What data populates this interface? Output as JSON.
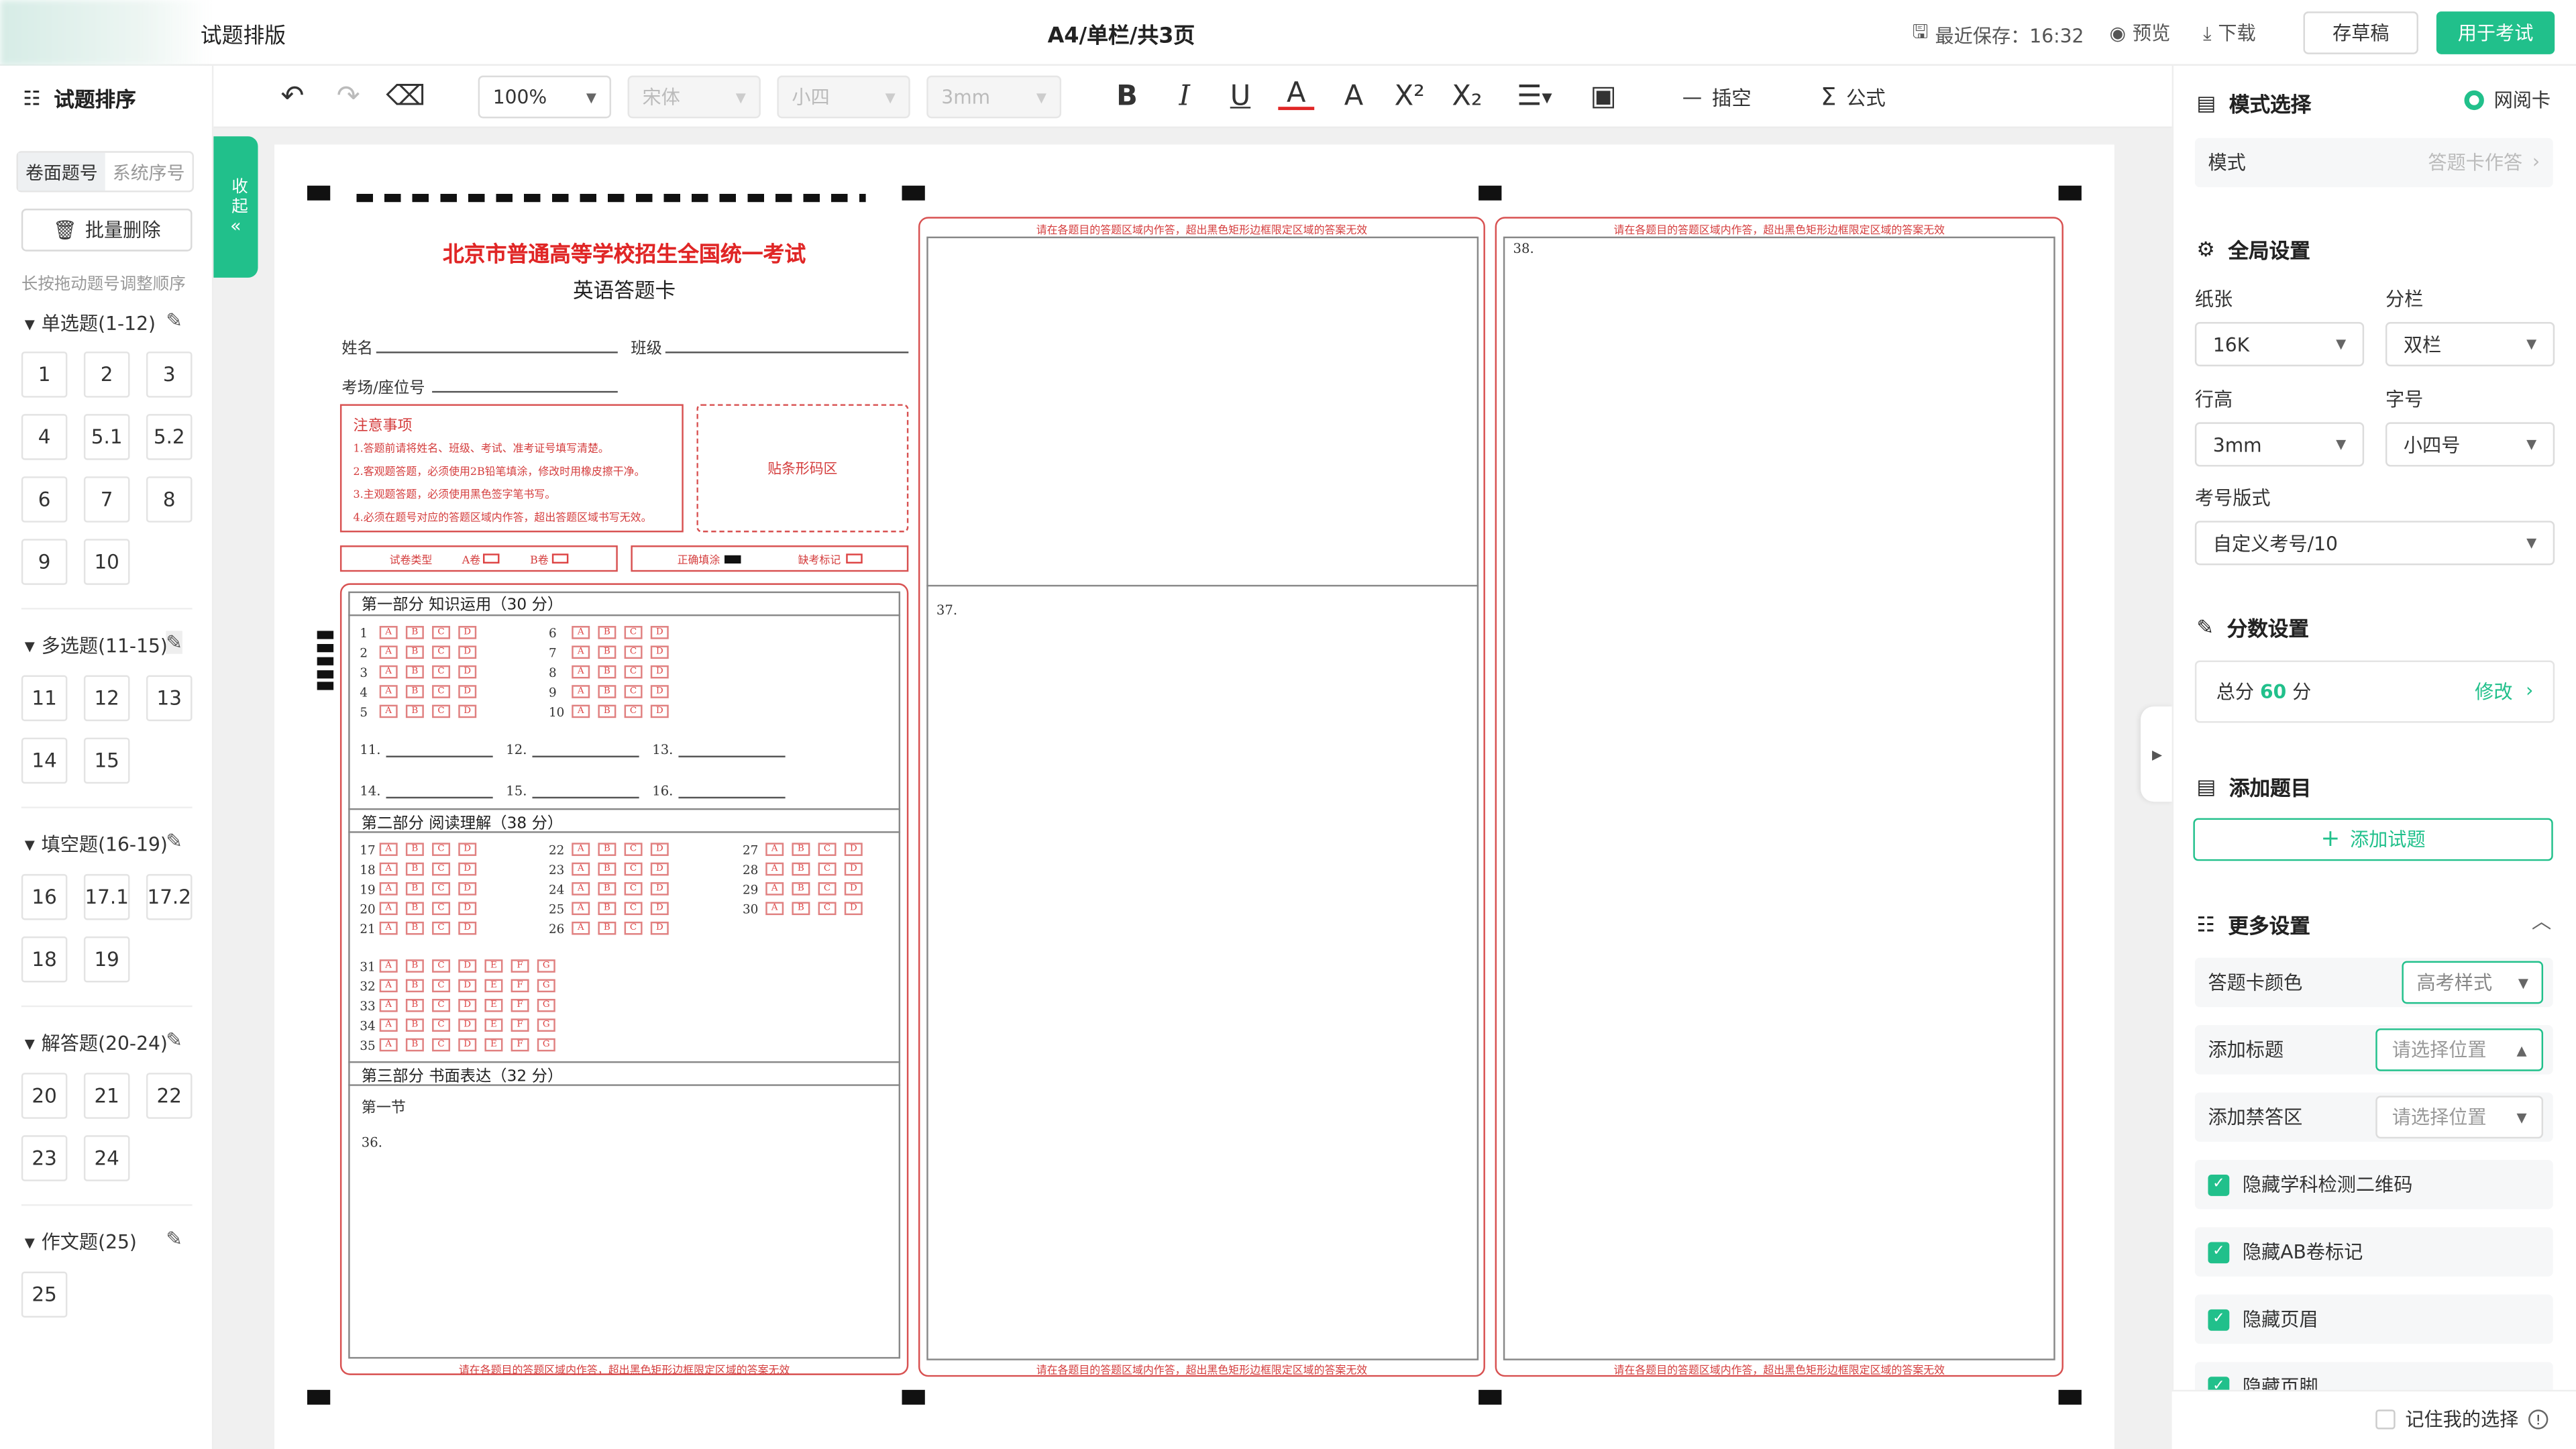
{
  "app": {
    "title": "试题排版",
    "page_info": "A4/单栏/共3页"
  },
  "topbar": {
    "last_save_label": "最近保存：16:32",
    "preview": "预览",
    "download": "下载",
    "save_draft": "存草稿",
    "use_for_exam": "用于考试"
  },
  "toolbar": {
    "zoom": "100%",
    "font": "宋体",
    "font_size": "小四",
    "line_height": "3mm",
    "insert_blank": "插空",
    "formula": "公式"
  },
  "left": {
    "title": "试题排序",
    "tabs": [
      "卷面题号",
      "系统序号"
    ],
    "batch_delete": "批量删除",
    "hint": "长按拖动题号调整顺序",
    "groups": [
      {
        "label": "单选题(1-12)",
        "items": [
          "1",
          "2",
          "3",
          "4",
          "5.1",
          "5.2",
          "6",
          "7",
          "8",
          "9",
          "10"
        ]
      },
      {
        "label": "多选题(11-15)",
        "items": [
          "11",
          "12",
          "13",
          "14",
          "15"
        ]
      },
      {
        "label": "填空题(16-19)",
        "items": [
          "16",
          "17.1",
          "17.2",
          "18",
          "19"
        ]
      },
      {
        "label": "解答题(20-24)",
        "items": [
          "20",
          "21",
          "22",
          "23",
          "24"
        ]
      },
      {
        "label": "作文题(25)",
        "items": [
          "25"
        ]
      }
    ],
    "collapse": "收起"
  },
  "sheet": {
    "title": "北京市普通高等学校招生全国统一考试",
    "subtitle": "英语答题卡",
    "name_label": "姓名",
    "class_label": "班级",
    "seat_label": "考场/座位号",
    "notice_title": "注意事项",
    "notices": [
      "1.答题前请将姓名、班级、考试、准考证号填写清楚。",
      "2.客观题答题，必须使用2B铅笔填涂，修改时用橡皮擦干净。",
      "3.主观题答题，必须使用黑色签字笔书写。",
      "4.必须在题号对应的答题区域内作答，超出答题区域书写无效。"
    ],
    "barcode": "贴条形码区",
    "paper_type": "试卷类型",
    "paper_a": "A卷",
    "paper_b": "B卷",
    "fill_correct": "正确填涂",
    "absent_mark": "缺考标记",
    "part1": "第一部分  知识运用（30 分）",
    "part2": "第二部分  阅读理解（38 分）",
    "part3": "第三部分  书面表达（32 分）",
    "section1": "第一节",
    "q36": "36.",
    "q37": "37.",
    "q38": "38.",
    "blanks": [
      "11.",
      "12.",
      "13.",
      "14.",
      "15.",
      "16."
    ],
    "area_notice": "请在各题目的答题区域内作答，超出黑色矩形边框限定区域的答案无效",
    "opts4": [
      "A",
      "B",
      "C",
      "D"
    ],
    "opts7": [
      "A",
      "B",
      "C",
      "D",
      "E",
      "F",
      "G"
    ]
  },
  "right": {
    "mode_select": "模式选择",
    "web_read": "网阅卡",
    "mode_label": "模式",
    "mode_value": "答题卡作答",
    "global_settings": "全局设置",
    "paper_label": "纸张",
    "paper_value": "16K",
    "columns_label": "分栏",
    "columns_value": "双栏",
    "line_label": "行高",
    "line_value": "3mm",
    "font_label": "字号",
    "font_value": "小四号",
    "exam_no_label": "考号版式",
    "exam_no_value": "自定义考号/10",
    "score_settings": "分数设置",
    "total_label": "总分",
    "total_value": "60",
    "total_unit": "分",
    "modify": "修改",
    "add_question": "添加题目",
    "add_question_btn": "添加试题",
    "more_settings": "更多设置",
    "card_color_label": "答题卡颜色",
    "card_color_value": "高考样式",
    "add_title_label": "添加标题",
    "add_title_placeholder": "请选择位置",
    "forbid_label": "添加禁答区",
    "forbid_placeholder": "请选择位置",
    "checks": [
      "隐藏学科检测二维码",
      "隐藏AB卷标记",
      "隐藏页眉",
      "隐藏页脚"
    ],
    "remember": "记住我的选择"
  },
  "colors": {
    "accent": "#21c08b",
    "sheet_red": "#d85151"
  }
}
